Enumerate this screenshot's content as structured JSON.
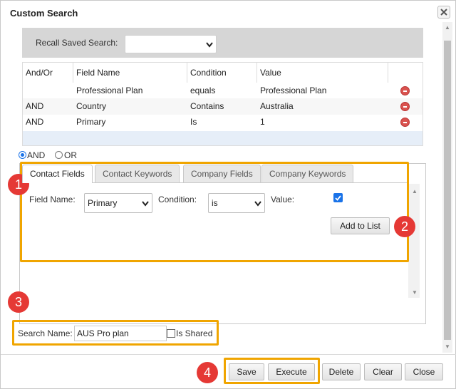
{
  "dialog": {
    "title": "Custom Search"
  },
  "recall": {
    "label": "Recall Saved Search:",
    "selected": ""
  },
  "table": {
    "headers": [
      "And/Or",
      "Field Name",
      "Condition",
      "Value"
    ],
    "rows": [
      {
        "andor": "",
        "field": "Professional Plan",
        "condition": "equals",
        "value": "Professional Plan"
      },
      {
        "andor": "AND",
        "field": "Country",
        "condition": "Contains",
        "value": "Australia"
      },
      {
        "andor": "AND",
        "field": "Primary",
        "condition": "Is",
        "value": "1"
      }
    ]
  },
  "logic": {
    "and_label": "AND",
    "or_label": "OR",
    "selected": "AND"
  },
  "tabs": [
    "Contact Fields",
    "Contact Keywords",
    "Company Fields",
    "Company Keywords"
  ],
  "form": {
    "field_name_label": "Field Name:",
    "field_name_value": "Primary",
    "condition_label": "Condition:",
    "condition_value": "is",
    "value_label": "Value:",
    "value_checked": true,
    "add_button": "Add to List"
  },
  "search_name": {
    "label": "Search Name:",
    "value": "AUS Pro plan",
    "is_shared_label": "Is Shared",
    "is_shared": false
  },
  "buttons": {
    "save": "Save",
    "execute": "Execute",
    "delete": "Delete",
    "clear": "Clear",
    "close": "Close"
  },
  "badges": [
    "1",
    "2",
    "3",
    "4"
  ],
  "colors": {
    "highlight": "#f0a500",
    "badge": "#e53935",
    "remove": "#d9534f",
    "accent": "#1a73e8"
  },
  "icons": {
    "close": "close-icon",
    "remove": "remove-circle-icon",
    "dropdown": "chevron-down-icon",
    "check": "checkmark-icon"
  }
}
